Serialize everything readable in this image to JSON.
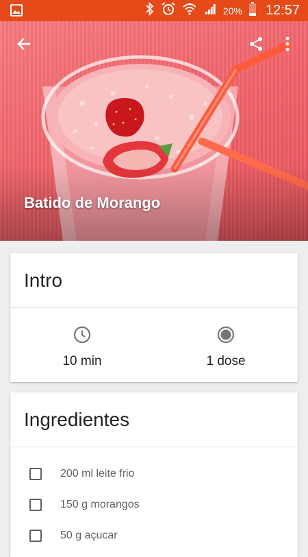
{
  "status_bar": {
    "battery_percent": "20%",
    "time": "12:57",
    "icons": [
      "image-icon",
      "bluetooth-icon",
      "alarm-icon",
      "wifi-icon",
      "signal-icon",
      "battery-icon"
    ],
    "color": "#e64a19"
  },
  "hero": {
    "title": "Batido de Morango",
    "back_icon": "arrow-back-icon",
    "share_icon": "share-icon",
    "menu_icon": "more-vert-icon"
  },
  "intro_card": {
    "title": "Intro",
    "time_icon": "clock-icon",
    "time_value": "10 min",
    "servings_icon": "servings-icon",
    "servings_value": "1 dose"
  },
  "ingredients_card": {
    "title": "Ingredientes",
    "items": [
      {
        "label": "200 ml leite frio",
        "checked": false
      },
      {
        "label": "150 g morangos",
        "checked": false
      },
      {
        "label": "50 g açucar",
        "checked": false
      }
    ]
  }
}
